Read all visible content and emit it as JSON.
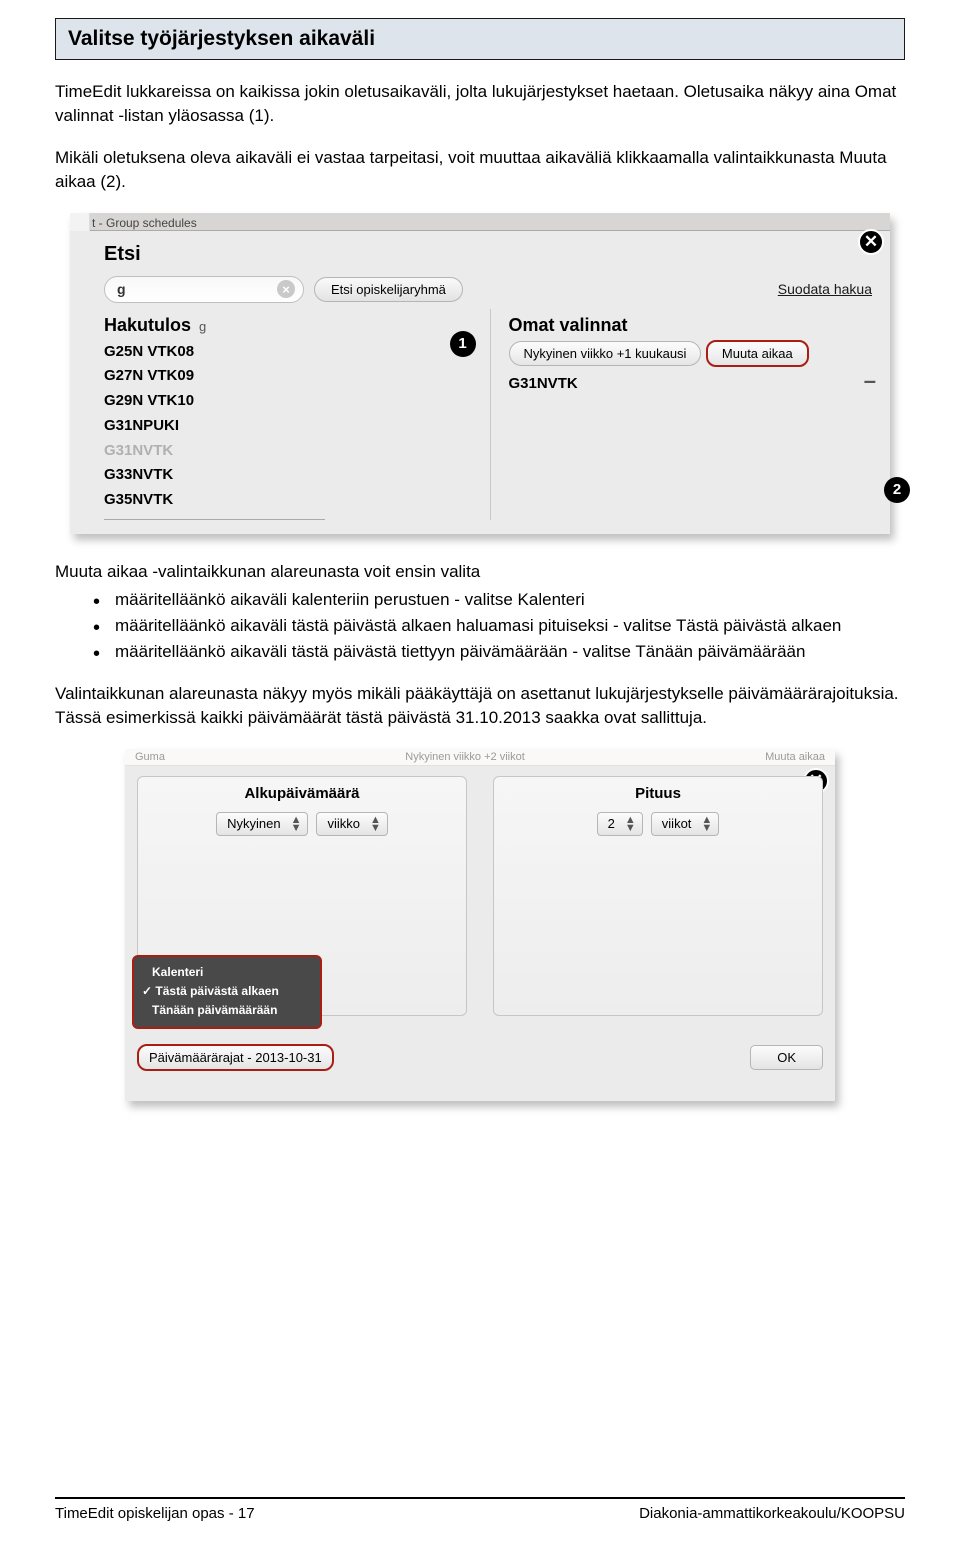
{
  "title": "Valitse työjärjestyksen aikaväli",
  "p1": "TimeEdit lukkareissa on kaikissa jokin oletusaikaväli, jolta lukujärjestykset haetaan. Oletusaika näkyy aina Omat valinnat -listan yläosassa (1).",
  "p2": "Mikäli oletuksena oleva aikaväli ei vastaa tarpeitasi, voit muuttaa aikaväliä klikkaamalla valintaikkunasta Muuta aikaa (2).",
  "p3": "Muuta aikaa -valintaikkunan alareunasta voit ensin valita",
  "bul1": "määritelläänkö aikaväli kalenteriin perustuen - valitse Kalenteri",
  "bul2": "määritelläänkö aikaväli tästä päivästä alkaen haluamasi pituiseksi - valitse Tästä päivästä alkaen",
  "bul3": "määritelläänkö aikaväli tästä päivästä tiettyyn päivämäärään - valitse Tänään päivämäärään",
  "p4": "Valintaikkunan alareunasta näkyy myös mikäli pääkäyttäjä on asettanut lukujärjestykselle päivämäärärajoituksia. Tässä esimerkissä kaikki päivämäärät tästä päivästä 31.10.2013 saakka ovat sallittuja.",
  "shot1": {
    "tabbar": "t - Group schedules",
    "etsi": "Etsi",
    "searchval": "g",
    "btn_etsi": "Etsi opiskelijaryhmä",
    "filter": "Suodata hakua",
    "hakutulos": "Hakutulos",
    "results": [
      "G25N VTK08",
      "G27N VTK09",
      "G29N VTK10",
      "G31NPUKI",
      "G31NVTK",
      "G33NVTK",
      "G35NVTK"
    ],
    "omat": "Omat valinnat",
    "cap_nyk": "Nykyinen viikko +1 kuukausi",
    "cap_muuta": "Muuta aikaa",
    "chosen": "G31NVTK"
  },
  "shot2": {
    "strip_dim": "Guma",
    "strip_mid": "Nykyinen viikko +2 viikot",
    "strip_right": "Muuta aikaa",
    "h_left": "Alkupäivämäärä",
    "h_right": "Pituus",
    "sel_nyk": "Nykyinen",
    "sel_vk": "viikko",
    "sel_2": "2",
    "sel_vkot": "viikot",
    "popup1": "Kalenteri",
    "popup2": "Tästä päivästä alkaen",
    "popup3": "Tänään päivämäärään",
    "pv": "Päivämäärärajat - 2013-10-31",
    "ok": "OK"
  },
  "footer_left": "TimeEdit opiskelijan opas - 17",
  "footer_right": "Diakonia-ammattikorkeakoulu/KOOPSU"
}
